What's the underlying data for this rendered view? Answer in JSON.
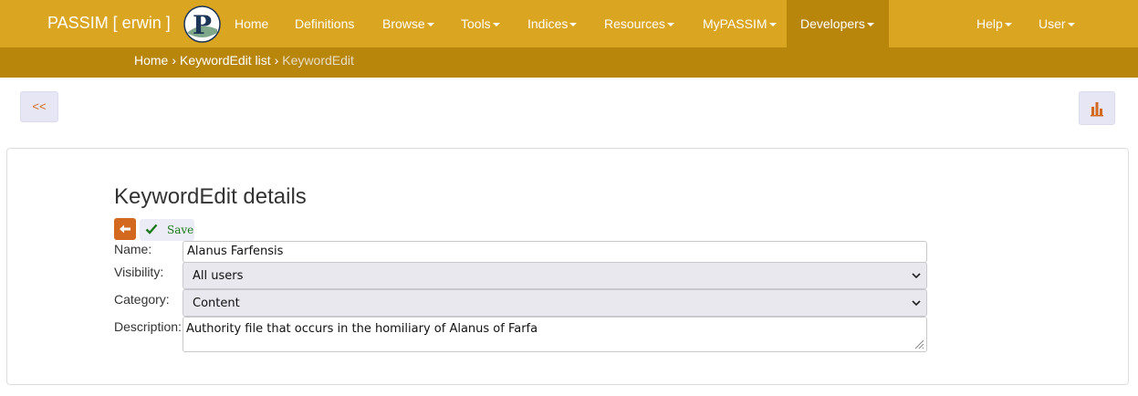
{
  "navbar": {
    "brand": "PASSIM [ erwin ]",
    "logo_icon": "passim-p-logo",
    "items": [
      {
        "label": "Home",
        "dropdown": false
      },
      {
        "label": "Definitions",
        "dropdown": false
      },
      {
        "label": "Browse",
        "dropdown": true
      },
      {
        "label": "Tools",
        "dropdown": true
      },
      {
        "label": "Indices",
        "dropdown": true
      },
      {
        "label": "Resources",
        "dropdown": true
      },
      {
        "label": "MyPASSIM",
        "dropdown": true
      },
      {
        "label": "Developers",
        "dropdown": true,
        "active": true
      },
      {
        "label": "Help",
        "dropdown": true
      },
      {
        "label": "User",
        "dropdown": true
      }
    ]
  },
  "breadcrumb": {
    "items": [
      "Home",
      "KeywordEdit list"
    ],
    "current": "KeywordEdit",
    "separator": "›"
  },
  "toolbar": {
    "back_label": "<<",
    "stats_icon": "bar-chart-icon"
  },
  "form": {
    "title": "KeywordEdit details",
    "back_icon": "arrow-left-icon",
    "save_label": "Save",
    "save_icon": "check-icon",
    "name_label": "Name:",
    "name_value": "Alanus Farfensis",
    "visibility_label": "Visibility:",
    "visibility_value": "All users",
    "category_label": "Category:",
    "category_value": "Content",
    "description_label": "Description:",
    "description_value": "Authority file that occurs in the homiliary of Alanus of Farfa"
  },
  "colors": {
    "navbar": "#daa520",
    "navbar_dark": "#b8860b",
    "accent": "#d2691e",
    "save_green": "#1a7a1a",
    "button_bg": "#e7e6f4"
  }
}
